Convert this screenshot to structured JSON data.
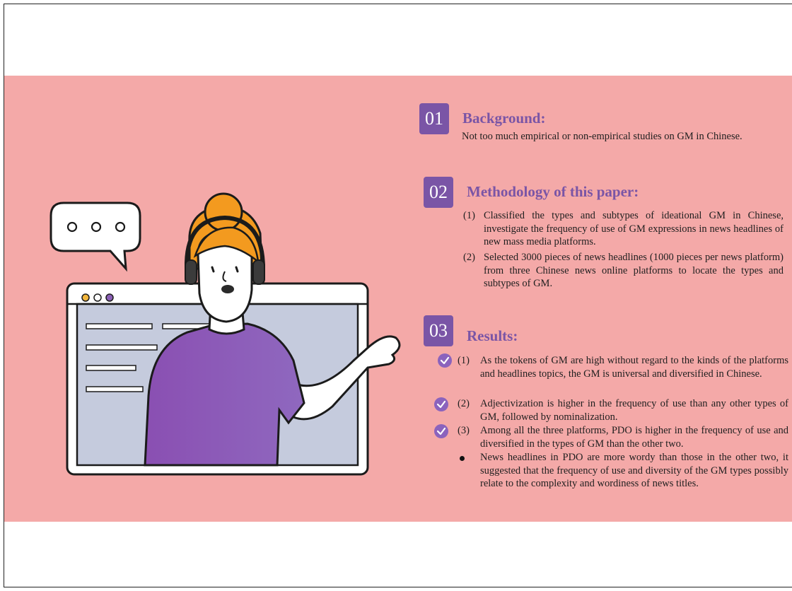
{
  "sections": {
    "s1": {
      "number": "01",
      "heading": "Background:",
      "body": "Not too much empirical or non-empirical studies on GM in Chinese."
    },
    "s2": {
      "number": "02",
      "heading": "Methodology of this paper:",
      "items": [
        {
          "num": "(1)",
          "text": "Classified the types and subtypes of ideational GM in Chinese, investigate the frequency of use of GM expressions in news headlines of new mass media platforms."
        },
        {
          "num": "(2)",
          "text": "Selected 3000 pieces of news headlines (1000 pieces per news platform) from three Chinese news online platforms to locate the types and subtypes of GM."
        }
      ]
    },
    "s3": {
      "number": "03",
      "heading": "Results:",
      "items": [
        {
          "num": "(1)",
          "text": "As the tokens of GM are high without regard to the kinds of the platforms and headlines topics, the GM is universal and diversified in Chinese."
        },
        {
          "num": "(2)",
          "text": "Adjectivization is higher in the frequency of use than any other types of GM, followed by nominalization."
        },
        {
          "num": "(3)",
          "text": "Among all the three platforms, PDO is higher in the frequency of use and diversified in the types of GM than the other two."
        }
      ],
      "bullet": "News headlines in PDO are more wordy than those in the other two, it suggested that the frequency of use and diversity of the GM types possibly relate to the complexity and wordiness of news titles."
    }
  },
  "illustration": {
    "speech_bubble_icon": "ellipsis-speech-bubble",
    "browser_icon": "browser-window",
    "person_icon": "support-agent-headset"
  },
  "colors": {
    "band": "#f4a9a8",
    "accent": "#7a55a6",
    "shirt": "#8a5fb5",
    "hair": "#f39a1f",
    "window": "#c5cbdd"
  }
}
